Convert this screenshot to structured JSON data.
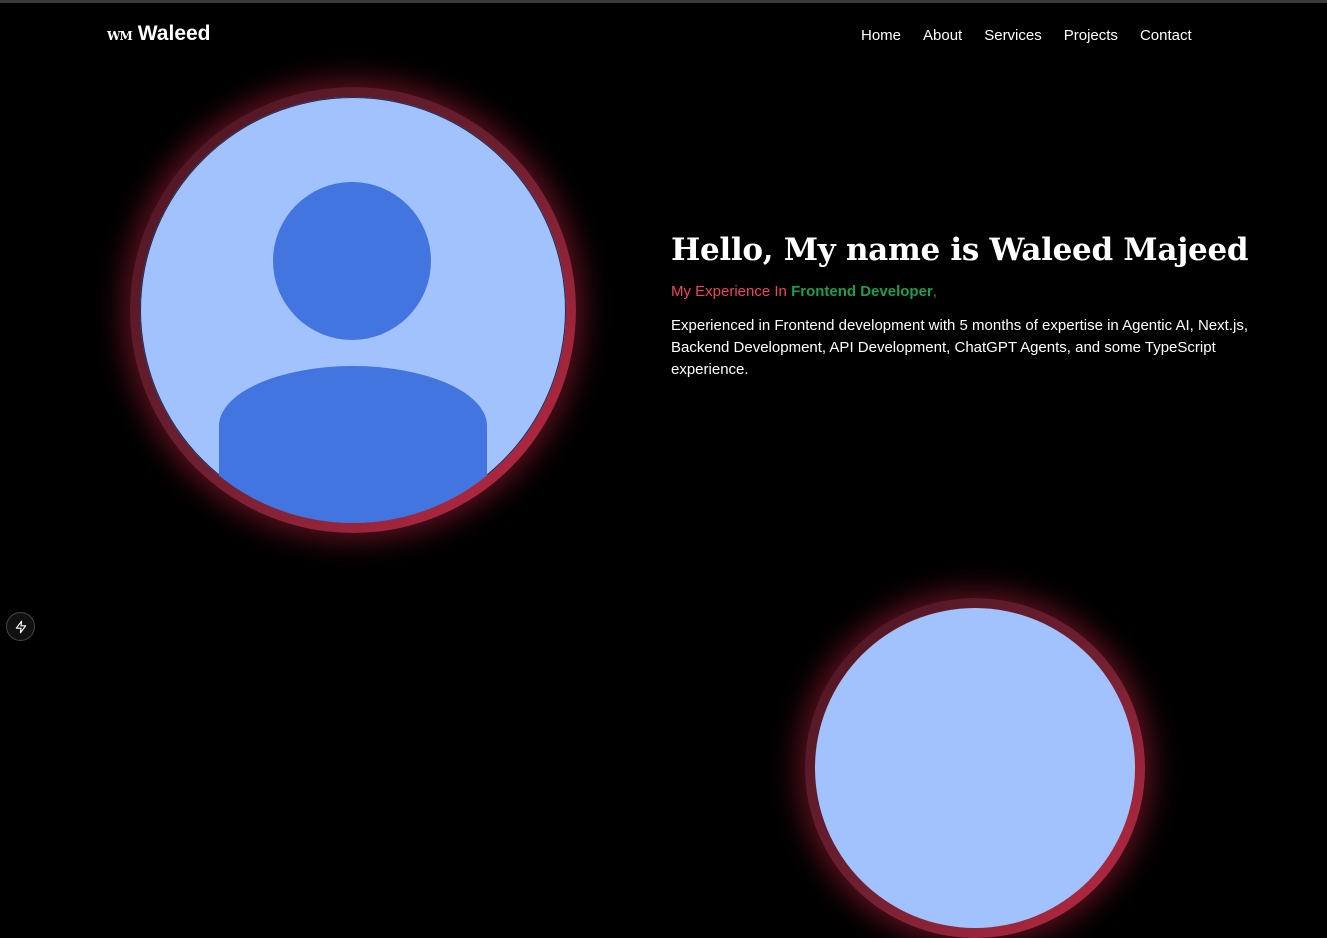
{
  "brand": {
    "mark": "WM",
    "name": "Waleed"
  },
  "nav": {
    "items": [
      {
        "label": "Home"
      },
      {
        "label": "About"
      },
      {
        "label": "Services"
      },
      {
        "label": "Projects"
      },
      {
        "label": "Contact"
      }
    ]
  },
  "hero": {
    "title": "Hello, My name is Waleed Majeed",
    "subtitle_prefix": "My Experience In ",
    "subtitle_highlight": "Frontend Developer",
    "subtitle_suffix": ",",
    "description": "Experienced in Frontend development with 5 months of expertise in Agentic AI, Next.js, Backend Development, API Development, ChatGPT Agents, and some TypeScript experience."
  },
  "colors": {
    "background": "#000000",
    "ring_glow": "#c42a45",
    "avatar_bg": "#a1c2fd",
    "avatar_fg": "#4375e0",
    "subtitle_prefix": "#e8485e",
    "subtitle_highlight": "#1f9d4f"
  },
  "icons": {
    "dev_badge": "lightning-bolt-icon",
    "avatar": "user-silhouette-icon"
  }
}
